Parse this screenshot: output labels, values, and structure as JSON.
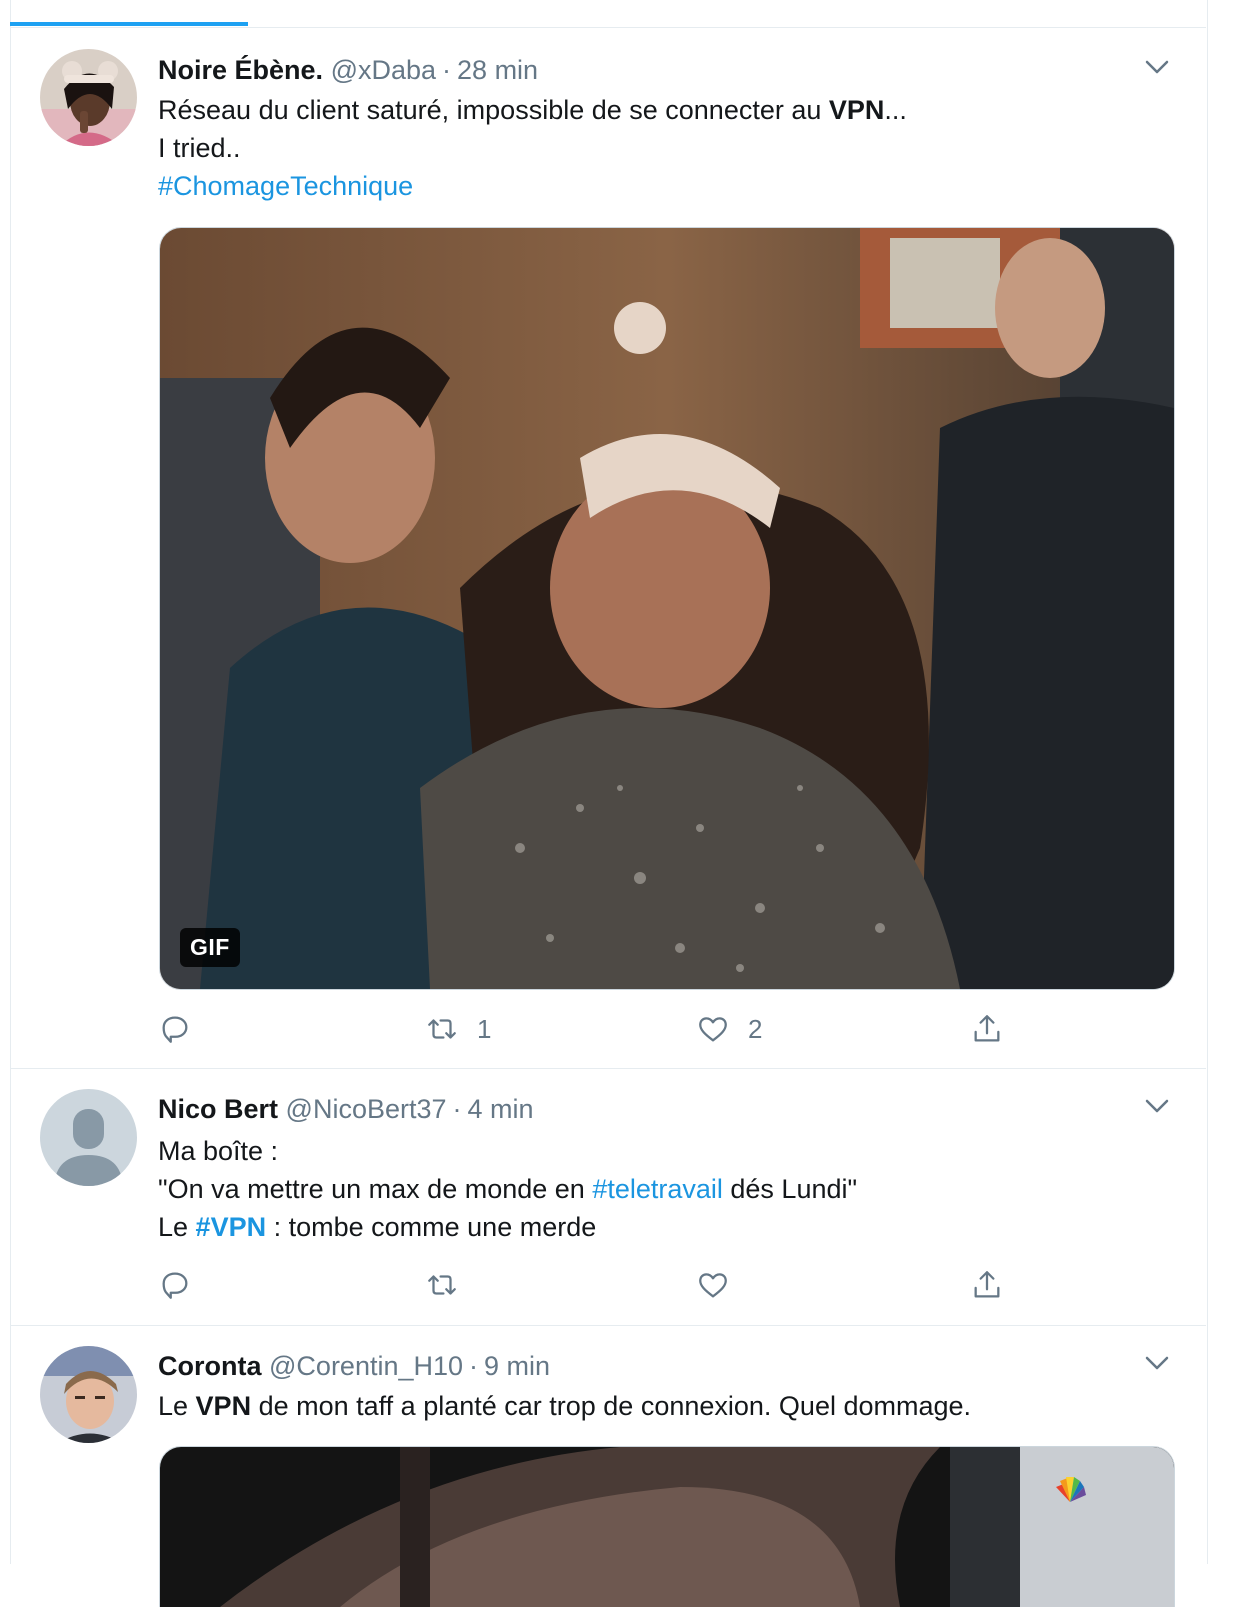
{
  "tweets": [
    {
      "name": "Noire Ébène.",
      "handle": "@xDaba",
      "separator": "·",
      "time": "28 min",
      "text_line1_pre": "Réseau du client saturé, impossible de se connecter au ",
      "text_line1_bold": "VPN",
      "text_line1_post": "...",
      "text_line2": "I tried..",
      "hashtag": "#ChomageTechnique",
      "media_badge": "GIF",
      "retweets": "1",
      "likes": "2"
    },
    {
      "name": "Nico Bert",
      "handle": "@NicoBert37",
      "separator": "·",
      "time": "4 min",
      "text_line1": "Ma boîte :",
      "text_line2_pre": "\"On va mettre un max de monde en ",
      "text_line2_hashtag": "#teletravail",
      "text_line2_post": " dés Lundi\"",
      "text_line3_pre": "Le ",
      "text_line3_hashtag": "#VPN",
      "text_line3_post": " : tombe comme une merde"
    },
    {
      "name": "Coronta",
      "handle": "@Corentin_H10",
      "separator": "·",
      "time": "9 min",
      "text_pre": "Le ",
      "text_bold": "VPN",
      "text_post": " de mon taff a planté car trop de connexion. Quel dommage."
    }
  ],
  "icons": {
    "reply": "reply-icon",
    "retweet": "retweet-icon",
    "like": "heart-icon",
    "share": "share-icon",
    "caret": "chevron-down-icon"
  },
  "colors": {
    "accent": "#1da1f2",
    "hashtag": "#1b95e0",
    "muted": "#657786",
    "border": "#e6ecf0"
  }
}
